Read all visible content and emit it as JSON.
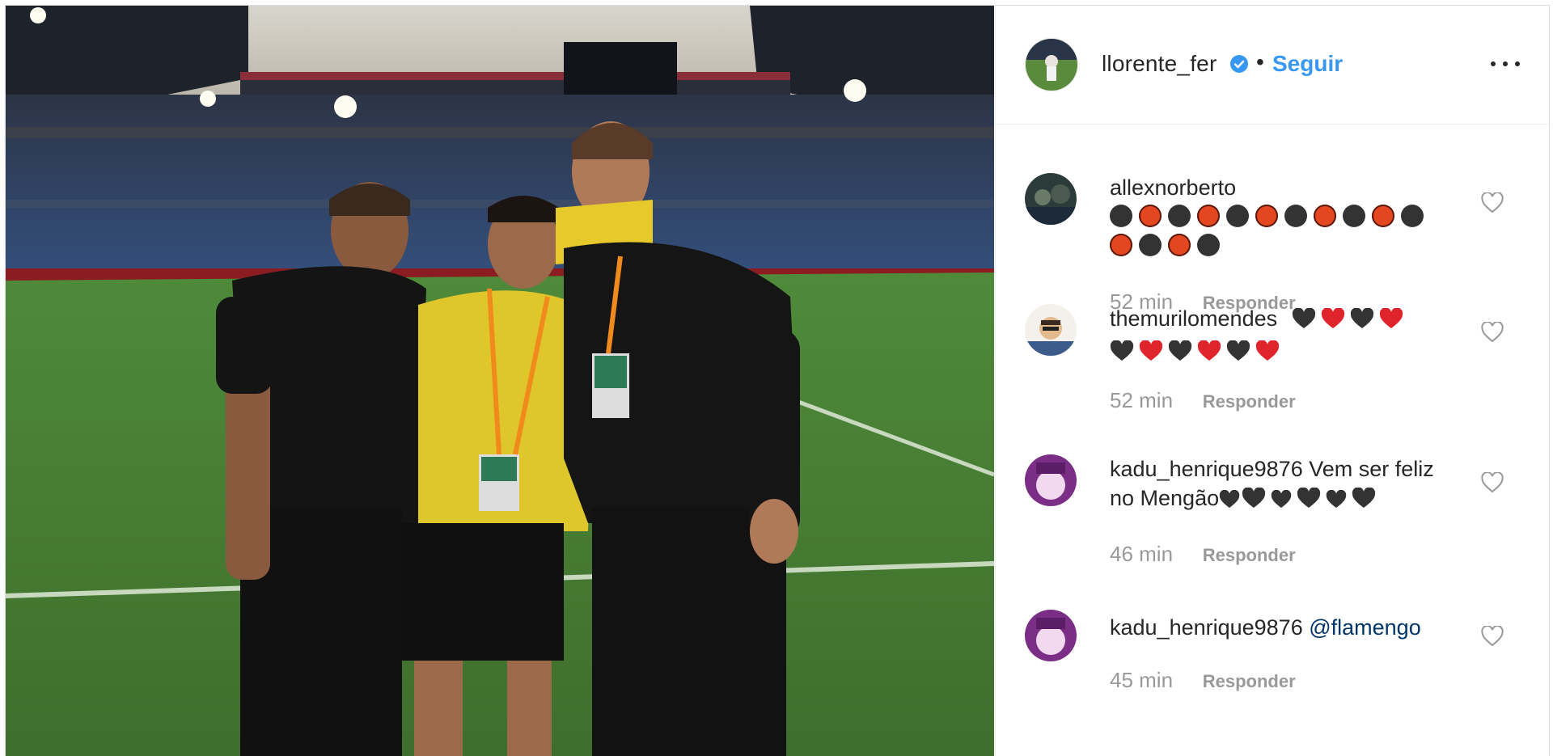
{
  "post": {
    "username": "llorente_fer",
    "verified": true,
    "separator": "•",
    "follow_label": "Seguir",
    "more_icon": "more-options-icon"
  },
  "comments": [
    {
      "username": "allexnorberto",
      "text": "",
      "emoji_line1": [
        "black",
        "orange",
        "black",
        "orange",
        "black",
        "orange",
        "black",
        "orange",
        "black",
        "orange",
        "black"
      ],
      "emoji_line2": [
        "orange",
        "black",
        "orange",
        "black"
      ],
      "time": "52 min",
      "reply_label": "Responder"
    },
    {
      "username": "themurilomendes",
      "text": "",
      "hearts_line1": [
        "black",
        "red",
        "black",
        "red"
      ],
      "hearts_line2": [
        "black",
        "red",
        "black",
        "red",
        "black",
        "red"
      ],
      "time": "52 min",
      "reply_label": "Responder"
    },
    {
      "username": "kadu_henrique9876",
      "text": "Vem ser feliz",
      "text2": "no Mengão",
      "hearts_line2": [
        "black",
        "black",
        "black",
        "black",
        "black",
        "black"
      ],
      "time": "46 min",
      "reply_label": "Responder"
    },
    {
      "username": "kadu_henrique9876",
      "mention": "@flamengo",
      "time": "45 min",
      "reply_label": "Responder"
    }
  ],
  "colors": {
    "link_blue": "#3897f0",
    "mention_blue": "#003569",
    "text": "#262626",
    "muted": "#999999",
    "border": "#dbdbdb"
  }
}
